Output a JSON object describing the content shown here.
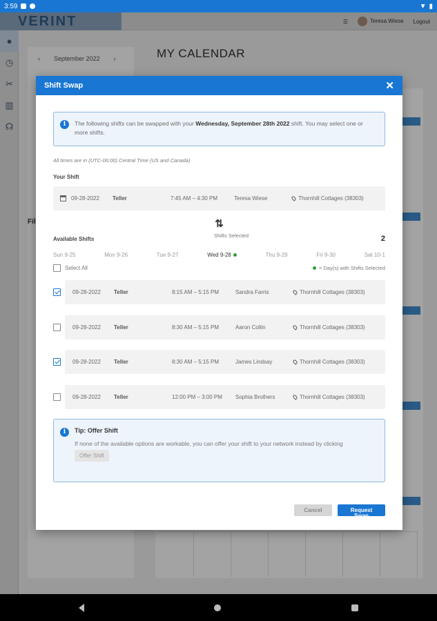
{
  "status_bar": {
    "time": "3:59"
  },
  "app": {
    "logo": "VERINT",
    "user_name": "Teresa Wiese",
    "logout": "Logout",
    "page_title": "MY CALENDAR",
    "month_label": "September 2022",
    "filter_label": "Fil"
  },
  "modal": {
    "title": "Shift Swap",
    "close_icon": "close-icon",
    "info": {
      "prefix": "The following shifts can be swapped with your ",
      "bold": "Wednesday, September 28th 2022",
      "suffix": " shift. You may select one or more shifts."
    },
    "timezone_note": "All times are in (UTC-06:00) Central Time (US and Canada)",
    "your_shift_label": "Your Shift",
    "your_shift": {
      "date": "09-28-2022",
      "role": "Teller",
      "time": "7:45 AM – 4:30 PM",
      "name": "Teresa Wiese",
      "location": "Thornhill Cottages (38303)"
    },
    "available_shifts_label": "Available Shifts",
    "shifts_selected_label": "Shifts Selected",
    "shifts_selected_count": "2",
    "days": [
      {
        "label": "Sun 9-25"
      },
      {
        "label": "Mon 9-26"
      },
      {
        "label": "Tue 9-27"
      },
      {
        "label": "Wed 9-28"
      },
      {
        "label": "Thu 9-29"
      },
      {
        "label": "Fri 9-30"
      },
      {
        "label": "Sat 10-1"
      }
    ],
    "select_all_label": "Select All",
    "legend_label": "= Day(s) with Shifts Selected",
    "available_shifts": [
      {
        "date": "09-28-2022",
        "role": "Teller",
        "time": "8:15 AM – 5:15 PM",
        "name": "Sandra Farris",
        "location": "Thornhill Cottages (38303)",
        "checked": true
      },
      {
        "date": "09-28-2022",
        "role": "Teller",
        "time": "8:30 AM – 5:15 PM",
        "name": "Aaron Collin",
        "location": "Thornhill Cottages (38303)",
        "checked": false
      },
      {
        "date": "09-28-2022",
        "role": "Teller",
        "time": "8:30 AM – 5:15 PM",
        "name": "James Lindsay",
        "location": "Thornhill Cottages (38303)",
        "checked": true
      },
      {
        "date": "09-28-2022",
        "role": "Teller",
        "time": "12:00 PM – 3:00 PM",
        "name": "Sophia Brothers",
        "location": "Thornhill Cottages (38303)",
        "checked": false
      }
    ],
    "tip": {
      "title": "Tip: Offer Shift",
      "text": "If none of the available options are workable, you can offer your shift to your network instead by clicking",
      "button": "Offer Shift"
    },
    "cancel_label": "Cancel",
    "request_label": "Request Swap"
  },
  "colors": {
    "accent": "#1976d2",
    "selected_dot": "#2e9d3a"
  }
}
